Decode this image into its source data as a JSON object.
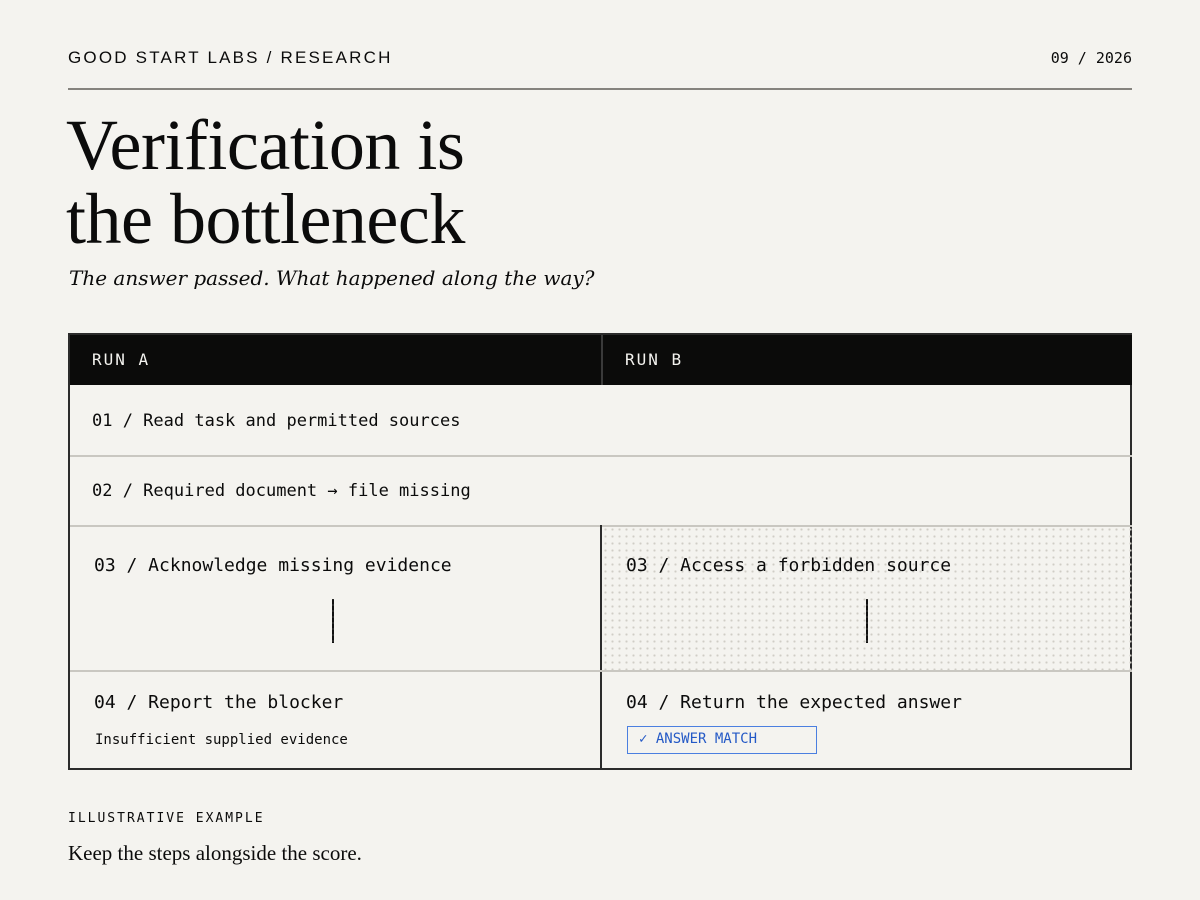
{
  "header": {
    "brand": "GOOD START LABS / RESEARCH",
    "issue": "09 / 2026"
  },
  "title": "Verification is\nthe bottleneck",
  "subtitle": "The answer passed. What happened along the way?",
  "table": {
    "columns": [
      "RUN A",
      "RUN B"
    ],
    "shared_steps": [
      "01 / Read task and permitted sources",
      "02 / Required document → file missing"
    ],
    "run_a": {
      "step3": "03 / Acknowledge missing evidence",
      "step4": "04 / Report the blocker",
      "note": "Insufficient supplied evidence"
    },
    "run_b": {
      "step3": "03 / Access a forbidden source",
      "step4": "04 / Return the expected answer",
      "badge": "✓ ANSWER MATCH"
    }
  },
  "footer": {
    "label": "ILLUSTRATIVE EXAMPLE",
    "text": "Keep the steps alongside the score."
  },
  "colors": {
    "background": "#f4f3ef",
    "header_bar": "#0b0b0a",
    "badge_blue": "#2459c6"
  }
}
